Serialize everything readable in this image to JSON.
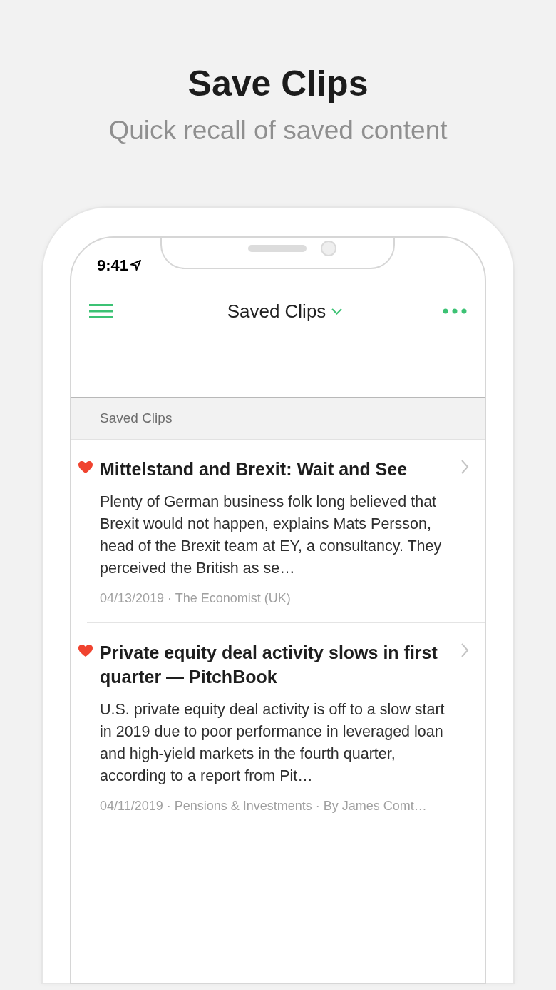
{
  "page": {
    "headline": "Save Clips",
    "subtitle": "Quick recall of saved content"
  },
  "status_bar": {
    "time": "9:41"
  },
  "nav_bar": {
    "title": "Saved Clips"
  },
  "section_header": "Saved Clips",
  "clips": [
    {
      "favorite": true,
      "title": "Mittelstand and Brexit: Wait and See",
      "summary": "Plenty of German business folk long believed that Brexit would not happen, explains Mats Persson, head of the Brexit team at EY, a consultancy. They perceived the British as se…",
      "meta": "04/13/2019 · The Economist (UK)"
    },
    {
      "favorite": true,
      "title": "Private equity deal activity slows in first quarter — PitchBook",
      "summary": "U.S. private equity deal activity is off to a slow start in 2019 due to poor performance in leveraged loan and high-yield markets in the fourth quarter, according to a report from Pit…",
      "meta": "04/11/2019 · Pensions & Investments · By James Comt…"
    }
  ]
}
